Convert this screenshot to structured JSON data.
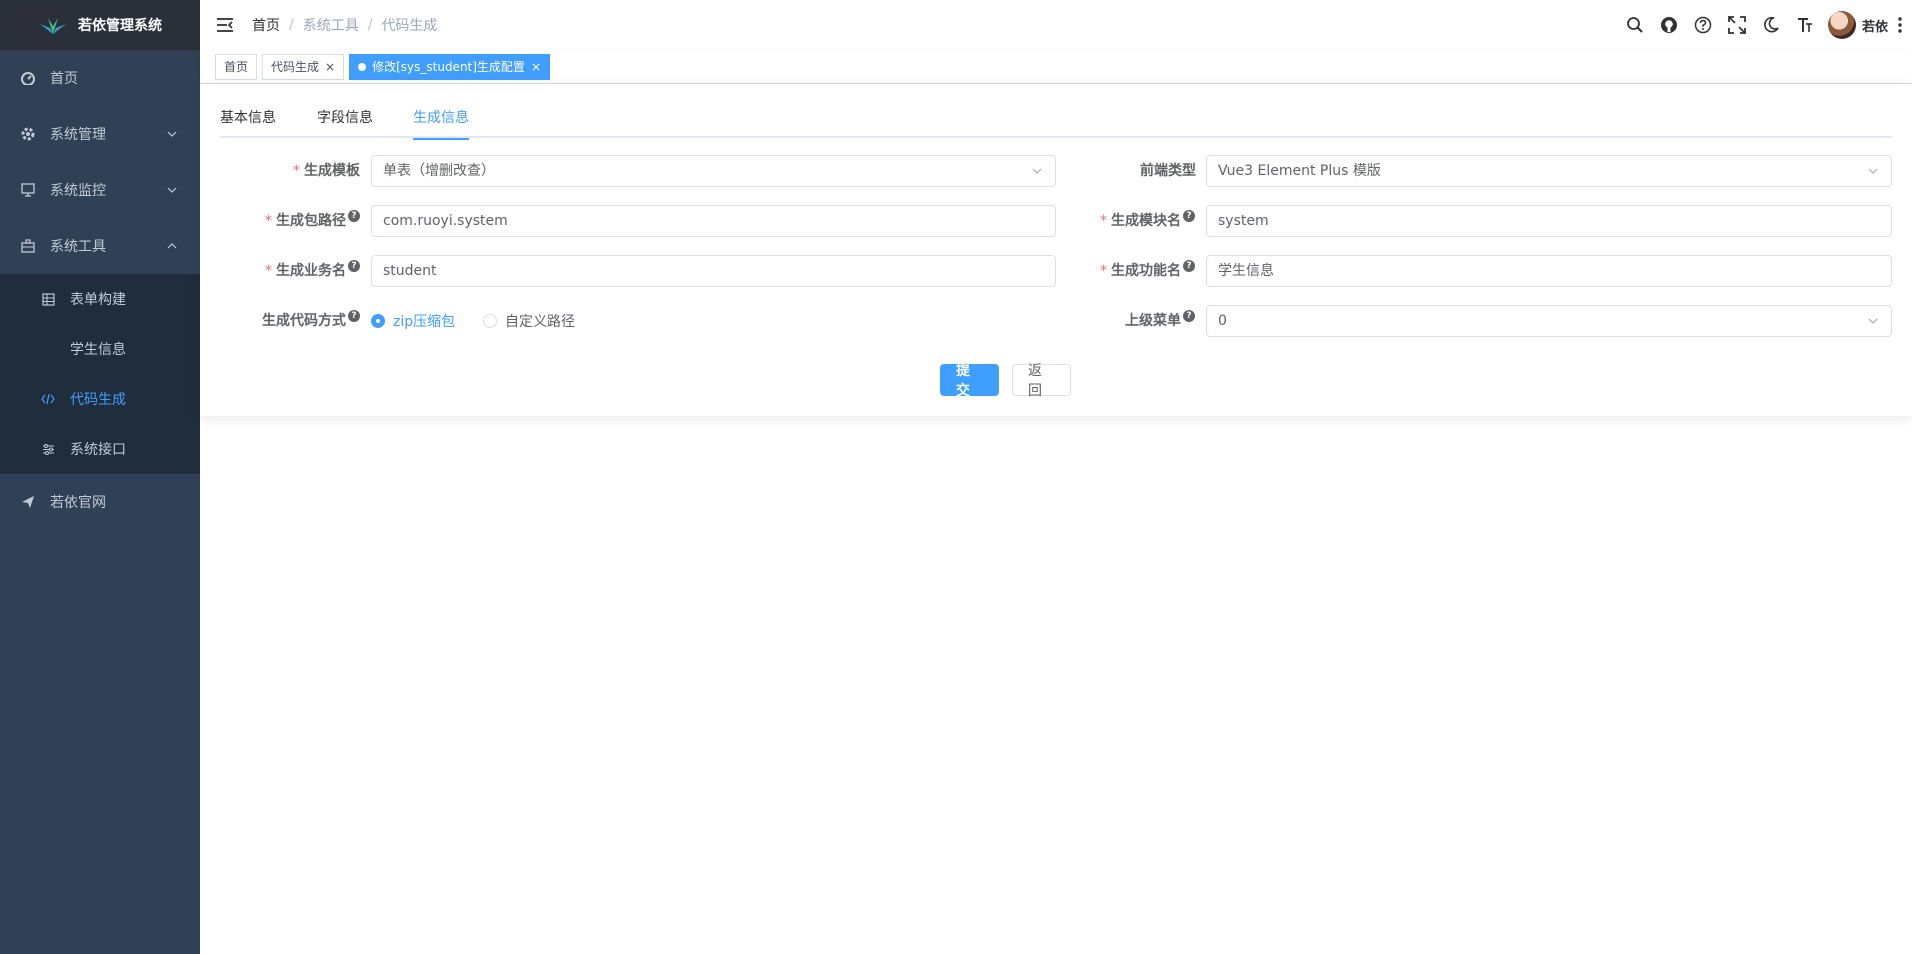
{
  "app": {
    "title": "若依管理系统"
  },
  "sidebar": {
    "items": [
      {
        "label": "首页",
        "icon": "dashboard-icon"
      },
      {
        "label": "系统管理",
        "icon": "gear-icon"
      },
      {
        "label": "系统监控",
        "icon": "monitor-icon"
      },
      {
        "label": "系统工具",
        "icon": "toolbox-icon",
        "expanded": true
      }
    ],
    "submenu": [
      {
        "label": "表单构建",
        "icon": "table-icon"
      },
      {
        "label": "学生信息",
        "icon": ""
      },
      {
        "label": "代码生成",
        "icon": "code-icon",
        "active": true
      },
      {
        "label": "系统接口",
        "icon": "sliders-icon"
      }
    ],
    "footer_item": {
      "label": "若依官网",
      "icon": "send-icon"
    }
  },
  "breadcrumb": [
    "首页",
    "系统工具",
    "代码生成"
  ],
  "breadcrumb_sep": "/",
  "user": {
    "name": "若依"
  },
  "tags": [
    {
      "label": "首页"
    },
    {
      "label": "代码生成",
      "close": "×"
    },
    {
      "label": "修改[sys_student]生成配置",
      "close": "×",
      "active": true
    }
  ],
  "tabs": [
    "基本信息",
    "字段信息",
    "生成信息"
  ],
  "active_tab": "生成信息",
  "form": {
    "required_mark": "*",
    "tpl_category": {
      "label": "生成模板",
      "value": "单表（增删改查）"
    },
    "frontend_type": {
      "label": "前端类型",
      "value": "Vue3 Element Plus 模版"
    },
    "package_name": {
      "label": "生成包路径",
      "value": "com.ruoyi.system"
    },
    "module_name": {
      "label": "生成模块名",
      "value": "system"
    },
    "business_name": {
      "label": "生成业务名",
      "value": "student"
    },
    "function_name": {
      "label": "生成功能名",
      "value": "学生信息"
    },
    "gen_type": {
      "label": "生成代码方式",
      "options": [
        "zip压缩包",
        "自定义路径"
      ],
      "selected": "zip压缩包"
    },
    "parent_menu": {
      "label": "上级菜单",
      "value": "0"
    }
  },
  "buttons": {
    "submit": "提交",
    "back": "返回"
  },
  "help_mark": "?",
  "colors": {
    "sidebar_bg": "#304156",
    "submenu_bg": "#1f2d3d",
    "primary": "#409eff",
    "required": "#f56c6c"
  }
}
